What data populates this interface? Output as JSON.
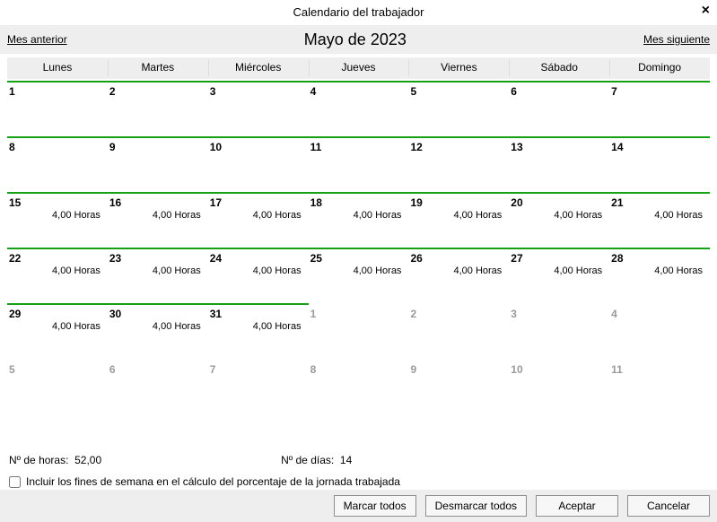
{
  "title": "Calendario del trabajador",
  "nav": {
    "prev": "Mes anterior",
    "next": "Mes siguiente",
    "month": "Mayo de 2023"
  },
  "weekdays": [
    "Lunes",
    "Martes",
    "Miércoles",
    "Jueves",
    "Viernes",
    "Sábado",
    "Domingo"
  ],
  "unit": "Horas",
  "weeks": [
    [
      {
        "n": "1",
        "active": true,
        "hours": ""
      },
      {
        "n": "2",
        "active": true,
        "hours": ""
      },
      {
        "n": "3",
        "active": true,
        "hours": ""
      },
      {
        "n": "4",
        "active": true,
        "hours": ""
      },
      {
        "n": "5",
        "active": true,
        "hours": ""
      },
      {
        "n": "6",
        "active": true,
        "hours": ""
      },
      {
        "n": "7",
        "active": true,
        "hours": ""
      }
    ],
    [
      {
        "n": "8",
        "active": true,
        "hours": ""
      },
      {
        "n": "9",
        "active": true,
        "hours": ""
      },
      {
        "n": "10",
        "active": true,
        "hours": ""
      },
      {
        "n": "11",
        "active": true,
        "hours": ""
      },
      {
        "n": "12",
        "active": true,
        "hours": ""
      },
      {
        "n": "13",
        "active": true,
        "hours": ""
      },
      {
        "n": "14",
        "active": true,
        "hours": ""
      }
    ],
    [
      {
        "n": "15",
        "active": true,
        "hours": "4,00"
      },
      {
        "n": "16",
        "active": true,
        "hours": "4,00"
      },
      {
        "n": "17",
        "active": true,
        "hours": "4,00"
      },
      {
        "n": "18",
        "active": true,
        "hours": "4,00"
      },
      {
        "n": "19",
        "active": true,
        "hours": "4,00"
      },
      {
        "n": "20",
        "active": true,
        "hours": "4,00"
      },
      {
        "n": "21",
        "active": true,
        "hours": "4,00"
      }
    ],
    [
      {
        "n": "22",
        "active": true,
        "hours": "4,00"
      },
      {
        "n": "23",
        "active": true,
        "hours": "4,00"
      },
      {
        "n": "24",
        "active": true,
        "hours": "4,00"
      },
      {
        "n": "25",
        "active": true,
        "hours": "4,00"
      },
      {
        "n": "26",
        "active": true,
        "hours": "4,00"
      },
      {
        "n": "27",
        "active": true,
        "hours": "4,00"
      },
      {
        "n": "28",
        "active": true,
        "hours": "4,00"
      }
    ],
    [
      {
        "n": "29",
        "active": true,
        "hours": "4,00"
      },
      {
        "n": "30",
        "active": true,
        "hours": "4,00"
      },
      {
        "n": "31",
        "active": true,
        "hours": "4,00"
      },
      {
        "n": "1",
        "active": false,
        "hours": ""
      },
      {
        "n": "2",
        "active": false,
        "hours": ""
      },
      {
        "n": "3",
        "active": false,
        "hours": ""
      },
      {
        "n": "4",
        "active": false,
        "hours": ""
      }
    ],
    [
      {
        "n": "5",
        "active": false,
        "hours": ""
      },
      {
        "n": "6",
        "active": false,
        "hours": ""
      },
      {
        "n": "7",
        "active": false,
        "hours": ""
      },
      {
        "n": "8",
        "active": false,
        "hours": ""
      },
      {
        "n": "9",
        "active": false,
        "hours": ""
      },
      {
        "n": "10",
        "active": false,
        "hours": ""
      },
      {
        "n": "11",
        "active": false,
        "hours": ""
      }
    ]
  ],
  "summary": {
    "hours_label": "Nº de horas:",
    "hours_value": "52,00",
    "days_label": "Nº de días:",
    "days_value": "14"
  },
  "checkbox_label": "Incluir los fines de semana en el cálculo del porcentaje de la jornada trabajada",
  "buttons": {
    "mark_all": "Marcar todos",
    "unmark_all": "Desmarcar todos",
    "accept": "Aceptar",
    "cancel": "Cancelar"
  }
}
